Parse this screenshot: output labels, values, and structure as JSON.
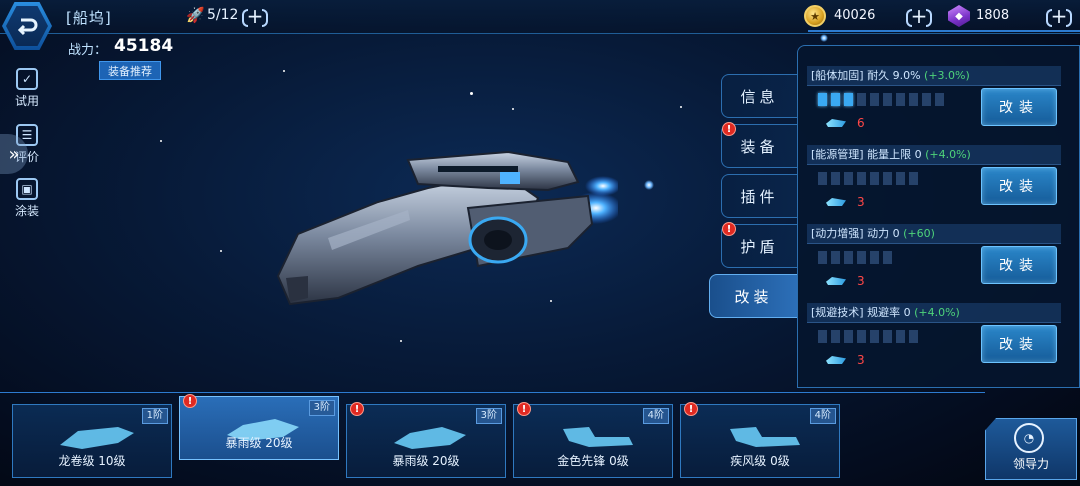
{
  "header": {
    "title": "[船坞]",
    "capacity": "5/12",
    "gold": "40026",
    "gems": "1808"
  },
  "power": {
    "label": "战力：",
    "value": "45184",
    "recommend": "装备推荐"
  },
  "side_tools": [
    {
      "label": "试用",
      "icon": "trial-icon"
    },
    {
      "label": "评价",
      "icon": "rating-icon"
    },
    {
      "label": "涂装",
      "icon": "paint-icon"
    }
  ],
  "menu": [
    {
      "label": "信息",
      "alert": false
    },
    {
      "label": "装备",
      "alert": true
    },
    {
      "label": "插件",
      "alert": false
    },
    {
      "label": "护盾",
      "alert": true
    },
    {
      "label": "改装",
      "alert": false,
      "active": true
    }
  ],
  "mods": [
    {
      "name": "[船体加固]",
      "stat": "耐久 9.0%",
      "bonus": "(+3.0%)",
      "level": 3,
      "max": 10,
      "cost": "6",
      "button": "改装"
    },
    {
      "name": "[能源管理]",
      "stat": "能量上限 0",
      "bonus": "(+4.0%)",
      "level": 0,
      "max": 8,
      "cost": "3",
      "button": "改装"
    },
    {
      "name": "[动力增强]",
      "stat": "动力 0",
      "bonus": "(+60)",
      "level": 0,
      "max": 6,
      "cost": "3",
      "button": "改装"
    },
    {
      "name": "[规避技术]",
      "stat": "规避率 0",
      "bonus": "(+4.0%)",
      "level": 0,
      "max": 8,
      "cost": "3",
      "button": "改装"
    }
  ],
  "ships": [
    {
      "name": "龙卷级 10级",
      "tier": "1阶",
      "alert": false,
      "selected": false
    },
    {
      "name": "暴雨级 20级",
      "tier": "3阶",
      "alert": true,
      "selected": true
    },
    {
      "name": "暴雨级 20级",
      "tier": "3阶",
      "alert": true,
      "selected": false
    },
    {
      "name": "金色先锋 0级",
      "tier": "4阶",
      "alert": true,
      "selected": false
    },
    {
      "name": "疾风级 0级",
      "tier": "4阶",
      "alert": true,
      "selected": false
    }
  ],
  "guide": {
    "label": "领导力"
  },
  "colors": {
    "accent": "#2d7bd0",
    "bonus": "#4ed37a",
    "alert": "#e02a22",
    "cost": "#ff4747"
  }
}
